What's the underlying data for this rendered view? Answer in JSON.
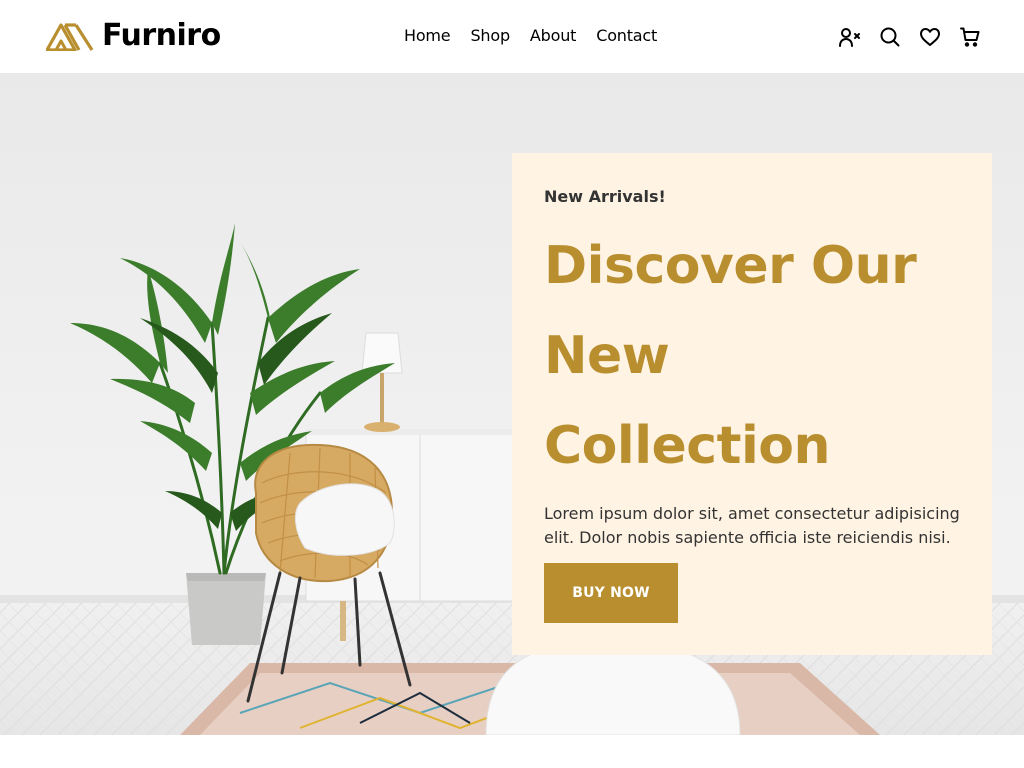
{
  "brand": {
    "name": "Furniro",
    "accent_color": "#b88e2f"
  },
  "nav": {
    "items": [
      {
        "label": "Home"
      },
      {
        "label": "Shop"
      },
      {
        "label": "About"
      },
      {
        "label": "Contact"
      }
    ]
  },
  "header_icons": [
    "user-alert-icon",
    "search-icon",
    "heart-icon",
    "cart-icon"
  ],
  "hero": {
    "eyebrow": "New Arrivals!",
    "title_lines": [
      "Discover Our",
      "New",
      "Collection"
    ],
    "description": "Lorem ipsum dolor sit, amet consectetur adipisicing elit. Dolor nobis sapiente officia iste reiciendis nisi.",
    "cta_label": "BUY NOW",
    "card_color": "#fff3e3",
    "title_color": "#b88e2f"
  }
}
